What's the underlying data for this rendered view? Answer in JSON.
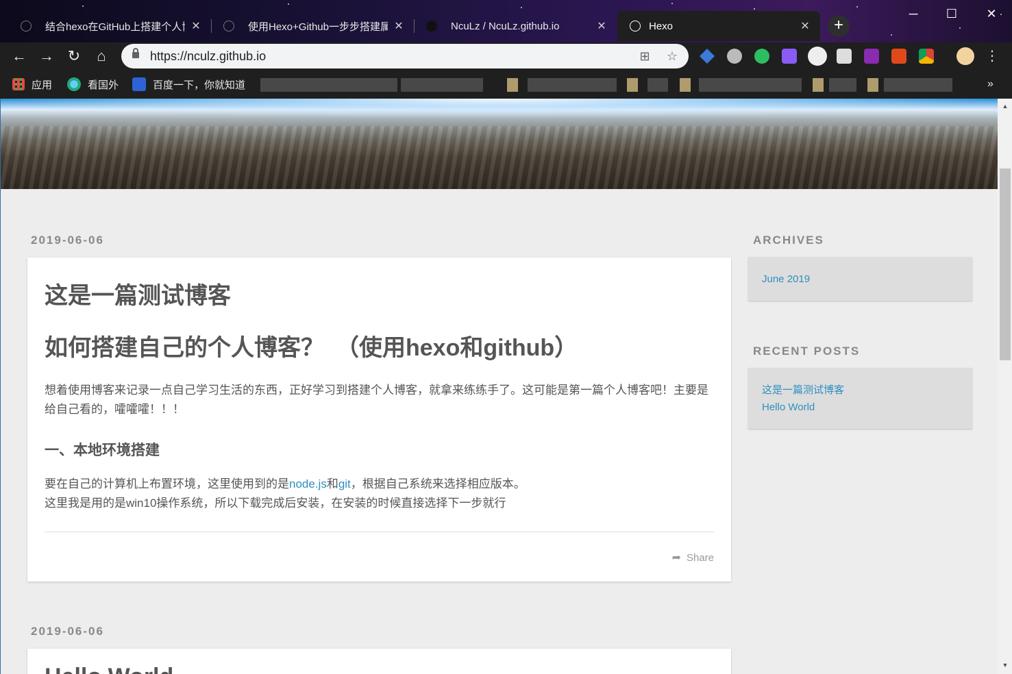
{
  "browser": {
    "tabs": [
      {
        "title": "结合hexo在GitHub上搭建个人博",
        "active": false
      },
      {
        "title": "使用Hexo+Github一步步搭建属",
        "active": false
      },
      {
        "title": "NcuLz / NcuLz.github.io",
        "active": false
      },
      {
        "title": "Hexo",
        "active": true
      }
    ],
    "url": "https://nculz.github.io",
    "bookmarks": [
      {
        "label": "应用",
        "icon": "apps-grid-icon"
      },
      {
        "label": "看国外",
        "icon": "globe-icon"
      },
      {
        "label": "百度一下，你就知道",
        "icon": "baidu-paw-icon"
      }
    ],
    "bookmarks_overflow": "»"
  },
  "posts": [
    {
      "date": "2019-06-06",
      "title": "这是一篇测试博客",
      "subtitle": "如何搭建自己的个人博客？　（使用hexo和github）",
      "intro": "想着使用博客来记录一点自己学习生活的东西，正好学习到搭建个人博客，就拿来练练手了。这可能是第一篇个人博客吧！主要是给自己看的，嚯嚯嚯！！！",
      "section_heading": "一、本地环境搭建",
      "env_line_before": "要在自己的计算机上布置环境，这里使用到的是",
      "env_link1": "node.js",
      "env_and": "和",
      "env_link2": "git",
      "env_line_after": "，根据自己系统来选择相应版本。",
      "env_line2": "这里我是用的是win10操作系统，所以下载完成后安装，在安装的时候直接选择下一步就行",
      "share_label": "Share"
    },
    {
      "date": "2019-06-06",
      "title": "Hello World"
    }
  ],
  "sidebar": {
    "archives_title": "ARCHIVES",
    "archives": [
      "June 2019"
    ],
    "recent_title": "RECENT POSTS",
    "recent_posts": [
      "这是一篇测试博客",
      "Hello World"
    ]
  }
}
